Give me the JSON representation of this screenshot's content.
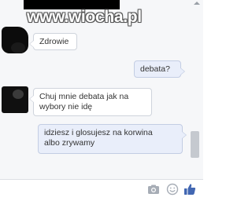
{
  "watermark": "www.wiocha.pl",
  "messages": [
    {
      "direction": "incoming",
      "text": "Zdrowie"
    },
    {
      "direction": "outgoing",
      "text": "debata?"
    },
    {
      "direction": "incoming",
      "lines": [
        "Chuj mnie debata jak na",
        "wybory nie idę"
      ]
    },
    {
      "direction": "outgoing",
      "lines": [
        "idziesz i glosujesz na korwina",
        "albo zrywamy"
      ]
    }
  ],
  "composer": {
    "value": "",
    "icons": [
      "camera-icon",
      "emoji-icon",
      "like-icon"
    ],
    "like_color": "#4267b2"
  }
}
